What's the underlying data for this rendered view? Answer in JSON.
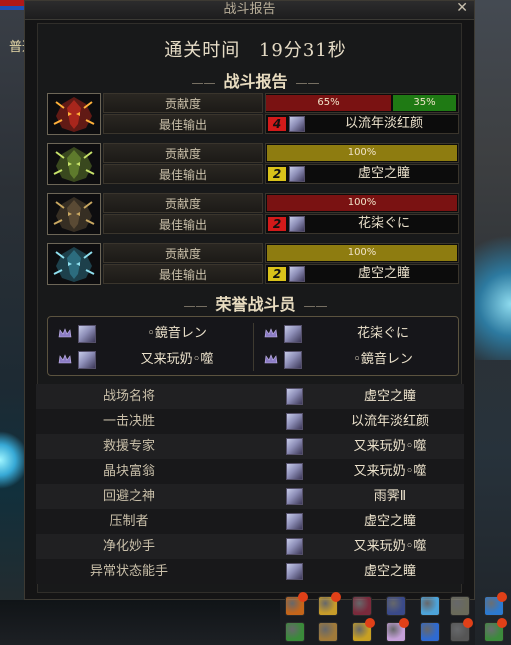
{
  "window": {
    "title": "战斗报告",
    "close_glyph": "✕"
  },
  "background": {
    "left_label": "普通"
  },
  "clear_time": {
    "label": "通关时间",
    "value": "19分31秒"
  },
  "report": {
    "section_title": "战斗报告",
    "contribution_label": "贡献度",
    "best_output_label": "最佳输出",
    "rows": [
      {
        "portrait": "red-demon-icon",
        "split": true,
        "left_pct_text": "65%",
        "left_fraction": 0.65,
        "right_pct_text": "35%",
        "right_fraction": 0.35,
        "left_color": "#7a1212",
        "right_color": "#1f7a14",
        "rank": "4",
        "rank_color": "#d21a1a",
        "player": "以流年淡红颜"
      },
      {
        "portrait": "green-demon-icon",
        "split": false,
        "pct_text": "100%",
        "fraction": 1.0,
        "bar_color": "#8e7c10",
        "rank": "2",
        "rank_color": "#d9c21a",
        "player": "虚空之瞳"
      },
      {
        "portrait": "dark-demon-icon",
        "split": false,
        "pct_text": "100%",
        "fraction": 1.0,
        "bar_color": "#7a1212",
        "rank": "2",
        "rank_color": "#d21a1a",
        "player": "花柒ぐに"
      },
      {
        "portrait": "blue-demon-icon",
        "split": false,
        "pct_text": "100%",
        "fraction": 1.0,
        "bar_color": "#8e7c10",
        "rank": "2",
        "rank_color": "#d9c21a",
        "player": "虚空之瞳"
      }
    ]
  },
  "honor": {
    "section_title": "荣誉战斗员",
    "members": [
      {
        "name": "◦鏡音レン"
      },
      {
        "name": "花柒ぐに"
      },
      {
        "name": "又来玩奶◦噬"
      },
      {
        "name": "◦鏡音レン"
      }
    ]
  },
  "titles": [
    {
      "title": "战场名将",
      "player": "虚空之瞳"
    },
    {
      "title": "一击决胜",
      "player": "以流年淡红颜"
    },
    {
      "title": "救援专家",
      "player": "又来玩奶◦噬"
    },
    {
      "title": "晶块富翁",
      "player": "又来玩奶◦噬"
    },
    {
      "title": "回避之神",
      "player": "雨霁Ⅱ"
    },
    {
      "title": "压制者",
      "player": "虚空之瞳"
    },
    {
      "title": "净化妙手",
      "player": "又来玩奶◦噬"
    },
    {
      "title": "异常状态能手",
      "player": "虚空之瞳"
    }
  ],
  "colors": {
    "panel_bg": "#141415",
    "text_gold": "#e6dcc6",
    "bar_red": "#7a1212",
    "bar_green": "#1f7a14",
    "bar_yellow": "#8e7c10"
  }
}
